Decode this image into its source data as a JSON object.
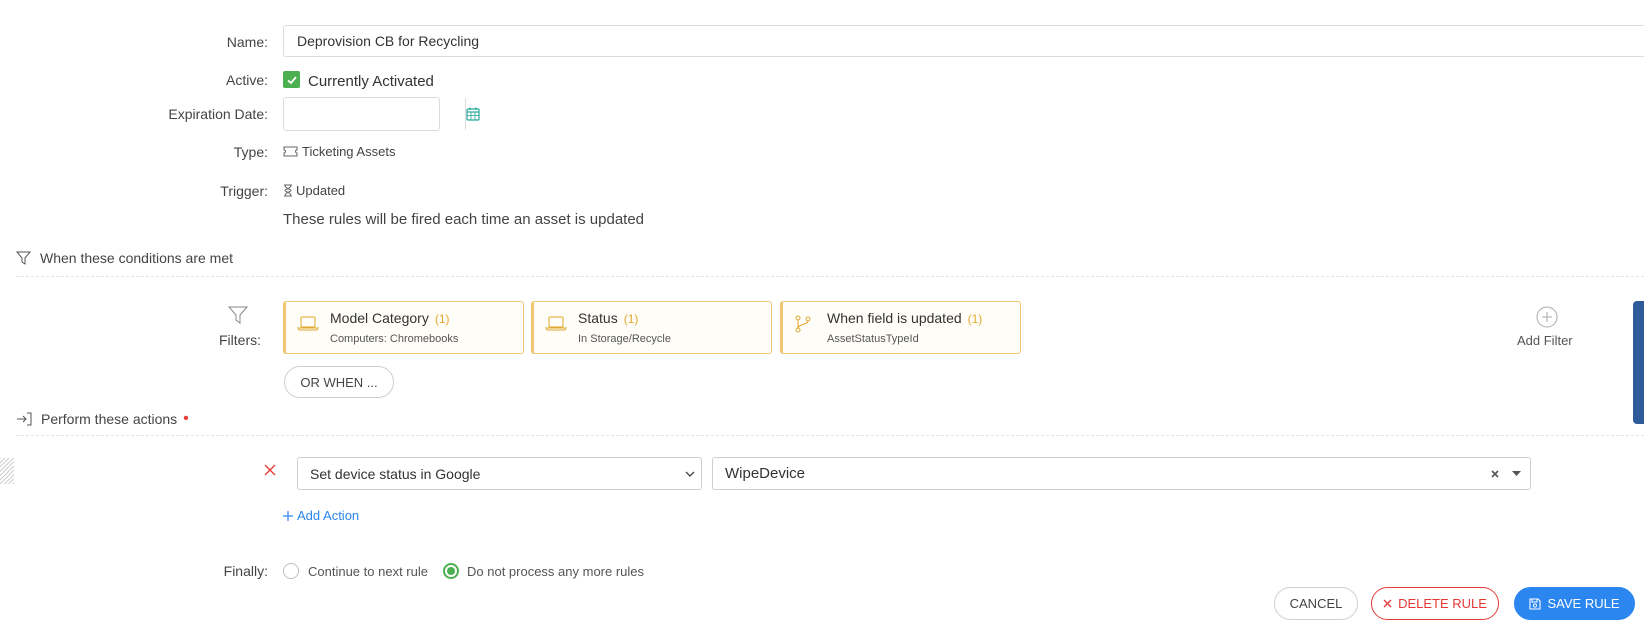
{
  "form": {
    "name_label": "Name:",
    "name_value": "Deprovision CB for Recycling",
    "active_label": "Active:",
    "active_text": "Currently Activated",
    "expiration_label": "Expiration Date:",
    "type_label": "Type:",
    "type_value": "Ticketing Assets",
    "trigger_label": "Trigger:",
    "trigger_value": "Updated",
    "trigger_note": "These rules will be fired each time an asset is updated"
  },
  "conditions": {
    "title": "When these conditions are met",
    "filters_label": "Filters:",
    "cards": [
      {
        "title": "Model Category",
        "count": "(1)",
        "subtitle": "Computers: Chromebooks"
      },
      {
        "title": "Status",
        "count": "(1)",
        "subtitle": "In Storage/Recycle"
      },
      {
        "title": "When field is updated",
        "count": "(1)",
        "subtitle": "AssetStatusTypeId"
      }
    ],
    "add_filter_label": "Add Filter",
    "or_when_label": "OR WHEN ..."
  },
  "actions": {
    "title": "Perform these actions",
    "required_mark": "•",
    "action_select_value": "Set device status in Google",
    "action_value": "WipeDevice",
    "add_action_label": "Add Action"
  },
  "finally": {
    "label": "Finally:",
    "option_continue": "Continue to next rule",
    "option_stop": "Do not process any more rules",
    "selected": "Do not process any more rules"
  },
  "buttons": {
    "cancel": "CANCEL",
    "delete": "DELETE RULE",
    "save": "SAVE RULE"
  },
  "colors": {
    "accent_blue": "#2b86f0",
    "danger_red": "#e53935",
    "success_green": "#4caf50",
    "filter_border": "#f0c674"
  }
}
